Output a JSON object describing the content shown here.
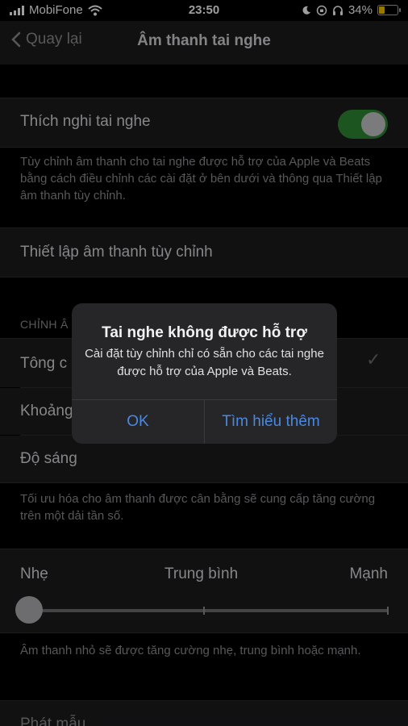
{
  "status_bar": {
    "carrier": "MobiFone",
    "time": "23:50",
    "battery": "34%"
  },
  "nav": {
    "back_label": "Quay lại",
    "title": "Âm thanh tai nghe"
  },
  "headphone_accommodations": {
    "label": "Thích nghi tai nghe",
    "enabled": true,
    "footer": "Tùy chỉnh âm thanh cho tai nghe được hỗ trợ của Apple và Beats bằng cách điều chỉnh các cài đặt ở bên dưới và thông qua Thiết lập âm thanh tùy chỉnh."
  },
  "custom_audio_setup": {
    "label": "Thiết lập âm thanh tùy chỉnh"
  },
  "tune_section": {
    "header": "CHỈNH Â",
    "items": [
      {
        "label": "Tông c",
        "checked": true
      },
      {
        "label": "Khoảng",
        "checked": false
      },
      {
        "label": "Độ sáng",
        "checked": false
      }
    ],
    "footer": "Tối ưu hóa cho âm thanh được cân bằng sẽ cung cấp tăng cường trên một dải tần số."
  },
  "boost_slider": {
    "min_label": "Nhẹ",
    "mid_label": "Trung bình",
    "max_label": "Mạnh",
    "value_fraction": 0,
    "footer": "Âm thanh nhỏ sẽ được tăng cường nhẹ, trung bình hoặc mạnh."
  },
  "play_sample": {
    "label": "Phát mẫu"
  },
  "alert": {
    "title": "Tai nghe không được hỗ trợ",
    "message": "Cài đặt tùy chỉnh chỉ có sẵn cho các tai nghe được hỗ trợ của Apple và Beats.",
    "ok_label": "OK",
    "learn_more_label": "Tìm hiểu thêm"
  },
  "colors": {
    "toggle_on": "#2f8a36",
    "link": "#2f6fd1",
    "alert_button": "#4a89e0",
    "battery": "#f5c400"
  }
}
